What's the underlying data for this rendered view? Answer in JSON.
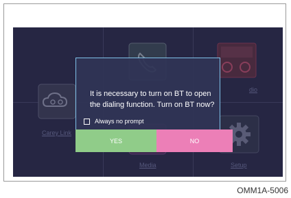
{
  "dialog": {
    "message_line1": "It is necessary to turn on BT to open",
    "message_line2": "the dialing function. Turn on BT now?",
    "checkbox_label": "Always no prompt",
    "checkbox_checked": false,
    "yes_label": "YES",
    "no_label": "NO"
  },
  "tiles": {
    "carry_link_label": "Carey Link",
    "media_label": "Media",
    "setup_label": "Setup",
    "radio_label": "dio"
  },
  "caption": "OMM1A-5006",
  "colors": {
    "screen_bg": "#2c2d4d",
    "dialog_border": "#7fc1e8",
    "yes_button": "#90cc89",
    "no_button": "#ec7fb7"
  },
  "icons": [
    "phone-icon",
    "link-cloud-icon",
    "radio-icon",
    "media-icon",
    "gear-icon"
  ]
}
